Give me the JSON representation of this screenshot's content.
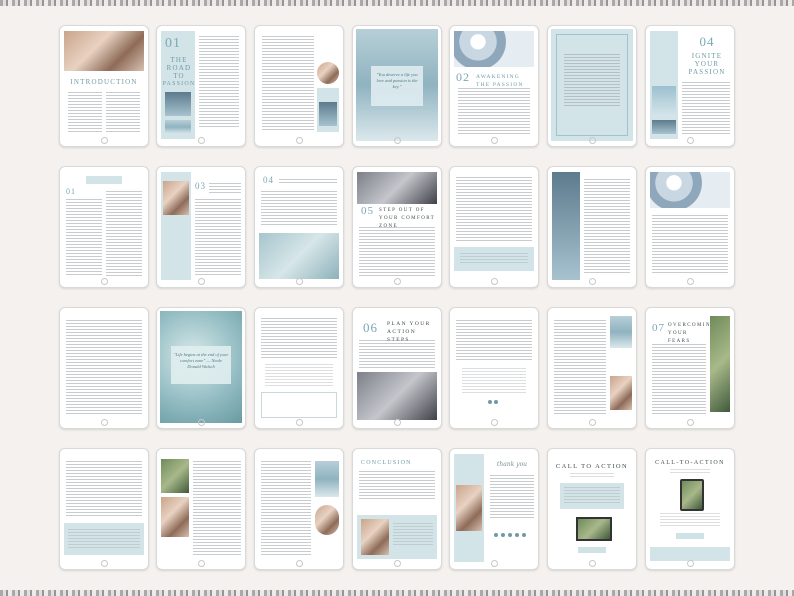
{
  "pages": {
    "introduction": {
      "heading": "INTRODUCTION"
    },
    "road_to_passion": {
      "number": "01",
      "line1": "THE",
      "line2": "ROAD",
      "line3": "TO",
      "line4": "PASSION"
    },
    "quote_page": {
      "text": "\"You deserve a life you love and passion is the key.\""
    },
    "awakening": {
      "number": "02",
      "heading": "AWAKENING THE PASSION"
    },
    "ignite": {
      "number": "04",
      "line1": "IGNITE",
      "line2": "YOUR",
      "line3": "PASSION"
    },
    "chapter03": {
      "number": "03"
    },
    "chapter04": {
      "number": "04"
    },
    "comfort_zone": {
      "number": "05",
      "heading": "STEP OUT OF YOUR COMFORT ZONE"
    },
    "quote2": {
      "text": "\"Life begins at the end of your comfort zone\" — Neale Donald Walsch"
    },
    "action_steps": {
      "number": "06",
      "heading": "PLAN YOUR ACTION STEPS"
    },
    "overcoming": {
      "number": "07",
      "heading": "OVERCOMING YOUR FEARS"
    },
    "conclusion": {
      "heading": "CONCLUSION"
    },
    "thank_you": {
      "text": "thank you"
    },
    "call_to_action": {
      "heading": "CALL TO ACTION"
    },
    "call_to_action2": {
      "heading": "CALL-TO-ACTION"
    }
  },
  "colors": {
    "accent": "#6f9aa6",
    "panel": "#d3e4e8",
    "background": "#f4f1ee"
  }
}
